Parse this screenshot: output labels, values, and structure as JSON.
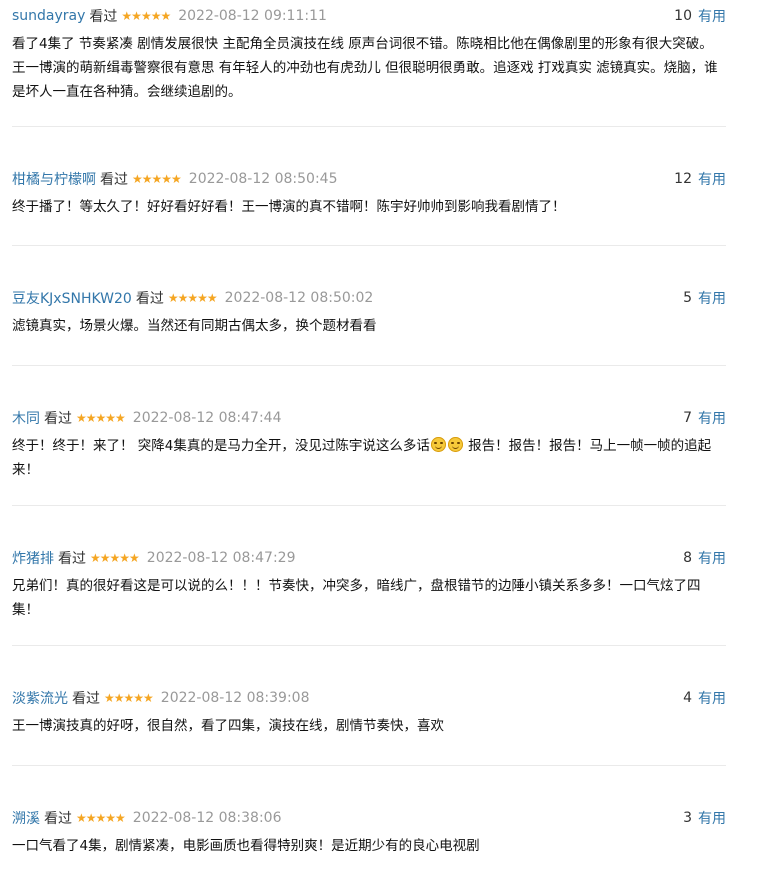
{
  "comments": [
    {
      "user": "sundayray",
      "watched_label": "看过",
      "stars": "★★★★★",
      "time": "2022-08-12 09:11:11",
      "votes": "10",
      "useful_label": "有用",
      "text": "看了4集了 节奏紧凑 剧情发展很快 主配角全员演技在线 原声台词很不错。陈晓相比他在偶像剧里的形象有很大突破。王一博演的萌新缉毒警察很有意思 有年轻人的冲劲也有虎劲儿 但很聪明很勇敢。追逐戏 打戏真实 滤镜真实。烧脑，谁是坏人一直在各种猜。会继续追剧的。"
    },
    {
      "user": "柑橘与柠檬啊",
      "watched_label": "看过",
      "stars": "★★★★★",
      "time": "2022-08-12 08:50:45",
      "votes": "12",
      "useful_label": "有用",
      "text": "终于播了！等太久了！好好看好好看！王一博演的真不错啊！陈宇好帅帅到影响我看剧情了！"
    },
    {
      "user": "豆友KJxSNHKW20",
      "watched_label": "看过",
      "stars": "★★★★★",
      "time": "2022-08-12 08:50:02",
      "votes": "5",
      "useful_label": "有用",
      "text": "滤镜真实，场景火爆。当然还有同期古偶太多，换个题材看看"
    },
    {
      "user": "木同",
      "watched_label": "看过",
      "stars": "★★★★★",
      "time": "2022-08-12 08:47:44",
      "votes": "7",
      "useful_label": "有用",
      "text_before": "终于！终于！来了！ 突降4集真的是马力全开，没见过陈宇说这么多话",
      "emoji_icon": "smirk-face-icon",
      "text_after": " 报告！报告！报告！马上一帧一帧的追起来！"
    },
    {
      "user": "炸猪排",
      "watched_label": "看过",
      "stars": "★★★★★",
      "time": "2022-08-12 08:47:29",
      "votes": "8",
      "useful_label": "有用",
      "text": "兄弟们！真的很好看这是可以说的么！！！节奏快，冲突多，暗线广，盘根错节的边陲小镇关系多多！一口气炫了四集！"
    },
    {
      "user": "淡紫流光",
      "watched_label": "看过",
      "stars": "★★★★★",
      "time": "2022-08-12 08:39:08",
      "votes": "4",
      "useful_label": "有用",
      "text": "王一博演技真的好呀，很自然，看了四集，演技在线，剧情节奏快，喜欢"
    },
    {
      "user": "溯溪",
      "watched_label": "看过",
      "stars": "★★★★★",
      "time": "2022-08-12 08:38:06",
      "votes": "3",
      "useful_label": "有用",
      "text": "一口气看了4集，剧情紧凑，电影画质也看得特别爽！是近期少有的良心电视剧"
    }
  ]
}
